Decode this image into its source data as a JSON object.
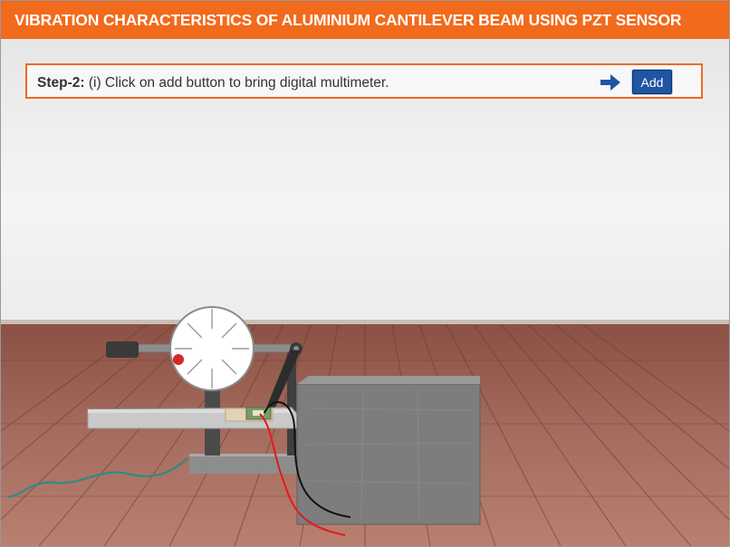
{
  "header": {
    "title": "VIBRATION CHARACTERISTICS OF ALUMINIUM CANTILEVER BEAM USING PZT SENSOR"
  },
  "instruction": {
    "step_label": "Step-2:",
    "text": " (i) Click on add button to bring digital multimeter."
  },
  "controls": {
    "add_label": "Add"
  },
  "colors": {
    "header_bg": "#f26a1b",
    "button_bg": "#1f55a3",
    "arrow": "#1f55a3",
    "wire_red": "#e01b1b",
    "wire_black": "#111111",
    "wire_teal": "#2f8a86"
  },
  "icons": {
    "next": "arrow-right-icon"
  }
}
